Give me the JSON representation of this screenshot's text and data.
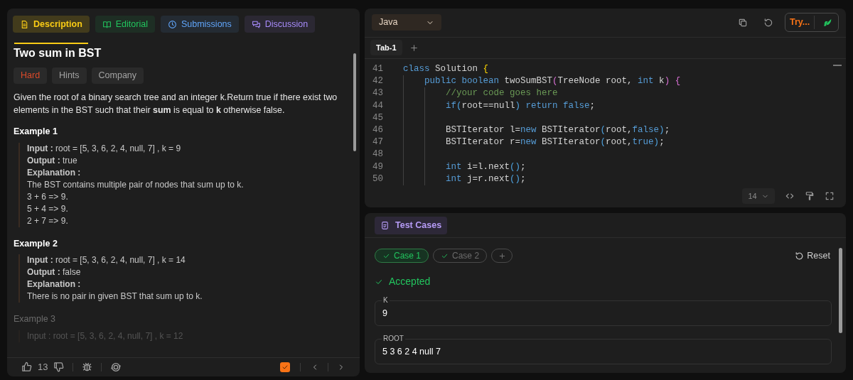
{
  "problem_tabs": [
    {
      "label": "Description",
      "selected": true,
      "color": "#facc15"
    },
    {
      "label": "Editorial",
      "selected": false,
      "color": "#22c55e"
    },
    {
      "label": "Submissions",
      "selected": false,
      "color": "#60a5fa"
    },
    {
      "label": "Discussion",
      "selected": false,
      "color": "#a78bfa"
    }
  ],
  "title": "Two sum in BST",
  "tags": [
    {
      "label": "Hard",
      "color": "#dc4a2a"
    },
    {
      "label": "Hints",
      "color": "#a3a3a3"
    },
    {
      "label": "Company",
      "color": "#a3a3a3"
    }
  ],
  "statement": "Given the root of a binary search tree and an integer k.Return true if there exist two elements in the BST such that their **sum** is equal to **k** otherwise false.",
  "examples": [
    {
      "title": "Example 1",
      "faded": false,
      "lines": [
        "**Input :** root = [5, 3, 6, 2, 4, null, 7] , k = 9",
        "**Output :** true",
        "**Explanation :**",
        "The BST contains multiple pair of nodes that sum up to k.",
        "3 + 6 => 9.",
        "5 + 4 => 9.",
        "2 + 7 => 9."
      ]
    },
    {
      "title": "Example 2",
      "faded": false,
      "lines": [
        "**Input :** root = [5, 3, 6, 2, 4, null, 7] , k = 14",
        "**Output :** false",
        "**Explanation :**",
        "There is no pair in given BST that sum up to k."
      ]
    },
    {
      "title": "Example 3",
      "faded": true,
      "lines": [
        "Input : root = [5, 3, 6, 2, 4, null, 7] , k = 12"
      ]
    }
  ],
  "footer": {
    "likes": "13",
    "marked": true
  },
  "editor": {
    "language": "Java",
    "try_button": "Try...",
    "tabs": [
      {
        "label": "Tab-1",
        "selected": true
      }
    ],
    "lines": [
      {
        "number": "41",
        "tokens": [
          {
            "text": "class",
            "kind": "keyword"
          },
          {
            "text": " Solution ",
            "kind": "plain"
          },
          {
            "text": "{",
            "kind": "brace"
          }
        ]
      },
      {
        "number": "42",
        "tokens": [
          {
            "text": "    public boolean",
            "kind": "keyword"
          },
          {
            "text": " twoSumBST",
            "kind": "plain"
          },
          {
            "text": "(",
            "kind": "paren"
          },
          {
            "text": "TreeNode root, ",
            "kind": "plain"
          },
          {
            "text": "int",
            "kind": "keyword"
          },
          {
            "text": " k",
            "kind": "plain"
          },
          {
            "text": ")",
            "kind": "paren"
          },
          {
            "text": " {",
            "kind": "paren"
          }
        ]
      },
      {
        "number": "43",
        "tokens": [
          {
            "text": "        //your code goes here",
            "kind": "comment"
          }
        ]
      },
      {
        "number": "44",
        "tokens": [
          {
            "text": "        if",
            "kind": "keyword"
          },
          {
            "text": "(",
            "kind": "bracket"
          },
          {
            "text": "root==null",
            "kind": "plain"
          },
          {
            "text": ")",
            "kind": "bracket"
          },
          {
            "text": " return false",
            "kind": "keyword"
          },
          {
            "text": ";",
            "kind": "plain"
          }
        ]
      },
      {
        "number": "45"
      },
      {
        "number": "46",
        "tokens": [
          {
            "text": "        BSTIterator l=",
            "kind": "plain"
          },
          {
            "text": "new",
            "kind": "keyword"
          },
          {
            "text": " BSTIterator",
            "kind": "plain"
          },
          {
            "text": "(",
            "kind": "bracket"
          },
          {
            "text": "root,",
            "kind": "plain"
          },
          {
            "text": "false",
            "kind": "keyword"
          },
          {
            "text": ")",
            "kind": "bracket"
          },
          {
            "text": ";",
            "kind": "plain"
          }
        ]
      },
      {
        "number": "47",
        "tokens": [
          {
            "text": "        BSTIterator r=",
            "kind": "plain"
          },
          {
            "text": "new",
            "kind": "keyword"
          },
          {
            "text": " BSTIterator",
            "kind": "plain"
          },
          {
            "text": "(",
            "kind": "bracket"
          },
          {
            "text": "root,",
            "kind": "plain"
          },
          {
            "text": "true",
            "kind": "keyword"
          },
          {
            "text": ")",
            "kind": "bracket"
          },
          {
            "text": ";",
            "kind": "plain"
          }
        ]
      },
      {
        "number": "48"
      },
      {
        "number": "49",
        "tokens": [
          {
            "text": "        int",
            "kind": "keyword"
          },
          {
            "text": " i=l.next",
            "kind": "plain"
          },
          {
            "text": "()",
            "kind": "bracket"
          },
          {
            "text": ";",
            "kind": "plain"
          }
        ]
      },
      {
        "number": "50",
        "tokens": [
          {
            "text": "        int",
            "kind": "keyword"
          },
          {
            "text": " j=r.next",
            "kind": "plain"
          },
          {
            "text": "()",
            "kind": "bracket"
          },
          {
            "text": ";",
            "kind": "plain"
          }
        ]
      }
    ],
    "font_size": "14"
  },
  "test_panel": {
    "tab": "Test Cases",
    "reset": "Reset",
    "cases": [
      {
        "label": "Case 1",
        "selected": true,
        "passed": true
      },
      {
        "label": "Case 2",
        "selected": false,
        "passed": true
      }
    ],
    "result": "Accepted",
    "inputs": [
      {
        "label": "K",
        "value": "9"
      },
      {
        "label": "ROOT",
        "value": "5 3 6 2 4 null 7"
      }
    ]
  }
}
